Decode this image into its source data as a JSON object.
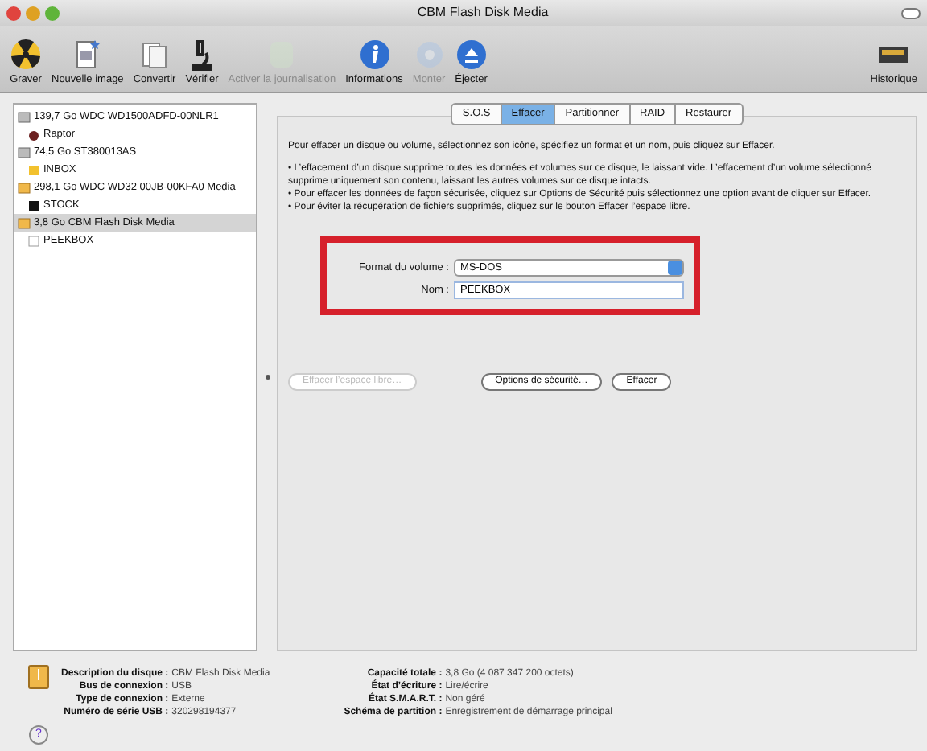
{
  "window": {
    "title": "CBM Flash Disk Media"
  },
  "toolbar": [
    {
      "label": "Graver",
      "kind": "burn",
      "disabled": false
    },
    {
      "label": "Nouvelle image",
      "kind": "newimage",
      "disabled": false
    },
    {
      "label": "Convertir",
      "kind": "convert",
      "disabled": false
    },
    {
      "label": "Vérifier",
      "kind": "verify",
      "disabled": false
    },
    {
      "label": "Activer la journalisation",
      "kind": "journal",
      "disabled": true
    },
    {
      "label": "Informations",
      "kind": "info",
      "disabled": false
    },
    {
      "label": "Monter",
      "kind": "mount",
      "disabled": true
    },
    {
      "label": "Éjecter",
      "kind": "eject",
      "disabled": false
    }
  ],
  "toolbar_right": {
    "label": "Historique"
  },
  "sidebar": {
    "items": [
      {
        "label": "139,7 Go WDC WD1500ADFD-00NLR1",
        "kind": "internal",
        "selected": false,
        "children": [
          {
            "label": "Raptor",
            "kind": "raptor",
            "selected": false
          }
        ]
      },
      {
        "label": "74,5 Go ST380013AS",
        "kind": "internal",
        "selected": false,
        "children": [
          {
            "label": "INBOX",
            "kind": "yellow",
            "selected": false
          }
        ]
      },
      {
        "label": "298,1 Go WDC WD32 00JB-00KFA0 Media",
        "kind": "external",
        "selected": false,
        "children": [
          {
            "label": "STOCK",
            "kind": "black",
            "selected": false
          }
        ]
      },
      {
        "label": "3,8 Go CBM Flash Disk Media",
        "kind": "external",
        "selected": true,
        "children": [
          {
            "label": "PEEKBOX",
            "kind": "white",
            "selected": false
          }
        ]
      }
    ]
  },
  "tabs": [
    {
      "label": "S.O.S",
      "selected": false
    },
    {
      "label": "Effacer",
      "selected": true
    },
    {
      "label": "Partitionner",
      "selected": false
    },
    {
      "label": "RAID",
      "selected": false
    },
    {
      "label": "Restaurer",
      "selected": false
    }
  ],
  "intro": "Pour effacer un disque ou volume, sélectionnez son icône, spécifiez un format et un nom, puis cliquez sur Effacer.",
  "notes": [
    "• L’effacement d’un disque supprime toutes les données et volumes sur ce disque, le laissant vide. L’effacement d’un volume sélectionné supprime uniquement son contenu, laissant les autres volumes sur ce disque intacts.",
    "• Pour effacer les données de façon sécurisée, cliquez sur Options de Sécurité puis sélectionnez une option avant de cliquer sur Effacer.",
    "• Pour éviter la récupération de fichiers supprimés, cliquez sur le bouton Effacer l’espace libre."
  ],
  "form": {
    "format_label": "Format du volume :",
    "format_value": "MS-DOS",
    "name_label": "Nom :",
    "name_value": "PEEKBOX"
  },
  "buttons": [
    {
      "label": "Effacer l’espace libre…",
      "disabled": true
    },
    {
      "label": "Options de sécurité…",
      "disabled": false
    },
    {
      "label": "Effacer",
      "disabled": false
    }
  ],
  "info_left": [
    {
      "label": "Description du disque :",
      "value": "CBM Flash Disk Media"
    },
    {
      "label": "Bus de connexion :",
      "value": "USB"
    },
    {
      "label": "Type de connexion :",
      "value": "Externe"
    },
    {
      "label": "Numéro de série USB :",
      "value": "320298194377"
    }
  ],
  "info_right": [
    {
      "label": "Capacité totale :",
      "value": "3,8 Go (4 087 347 200 octets)"
    },
    {
      "label": "État d’écriture :",
      "value": "Lire/écrire"
    },
    {
      "label": "État S.M.A.R.T. :",
      "value": "Non géré"
    },
    {
      "label": "Schéma de partition :",
      "value": "Enregistrement de démarrage principal"
    }
  ],
  "help": {
    "label": "?"
  }
}
